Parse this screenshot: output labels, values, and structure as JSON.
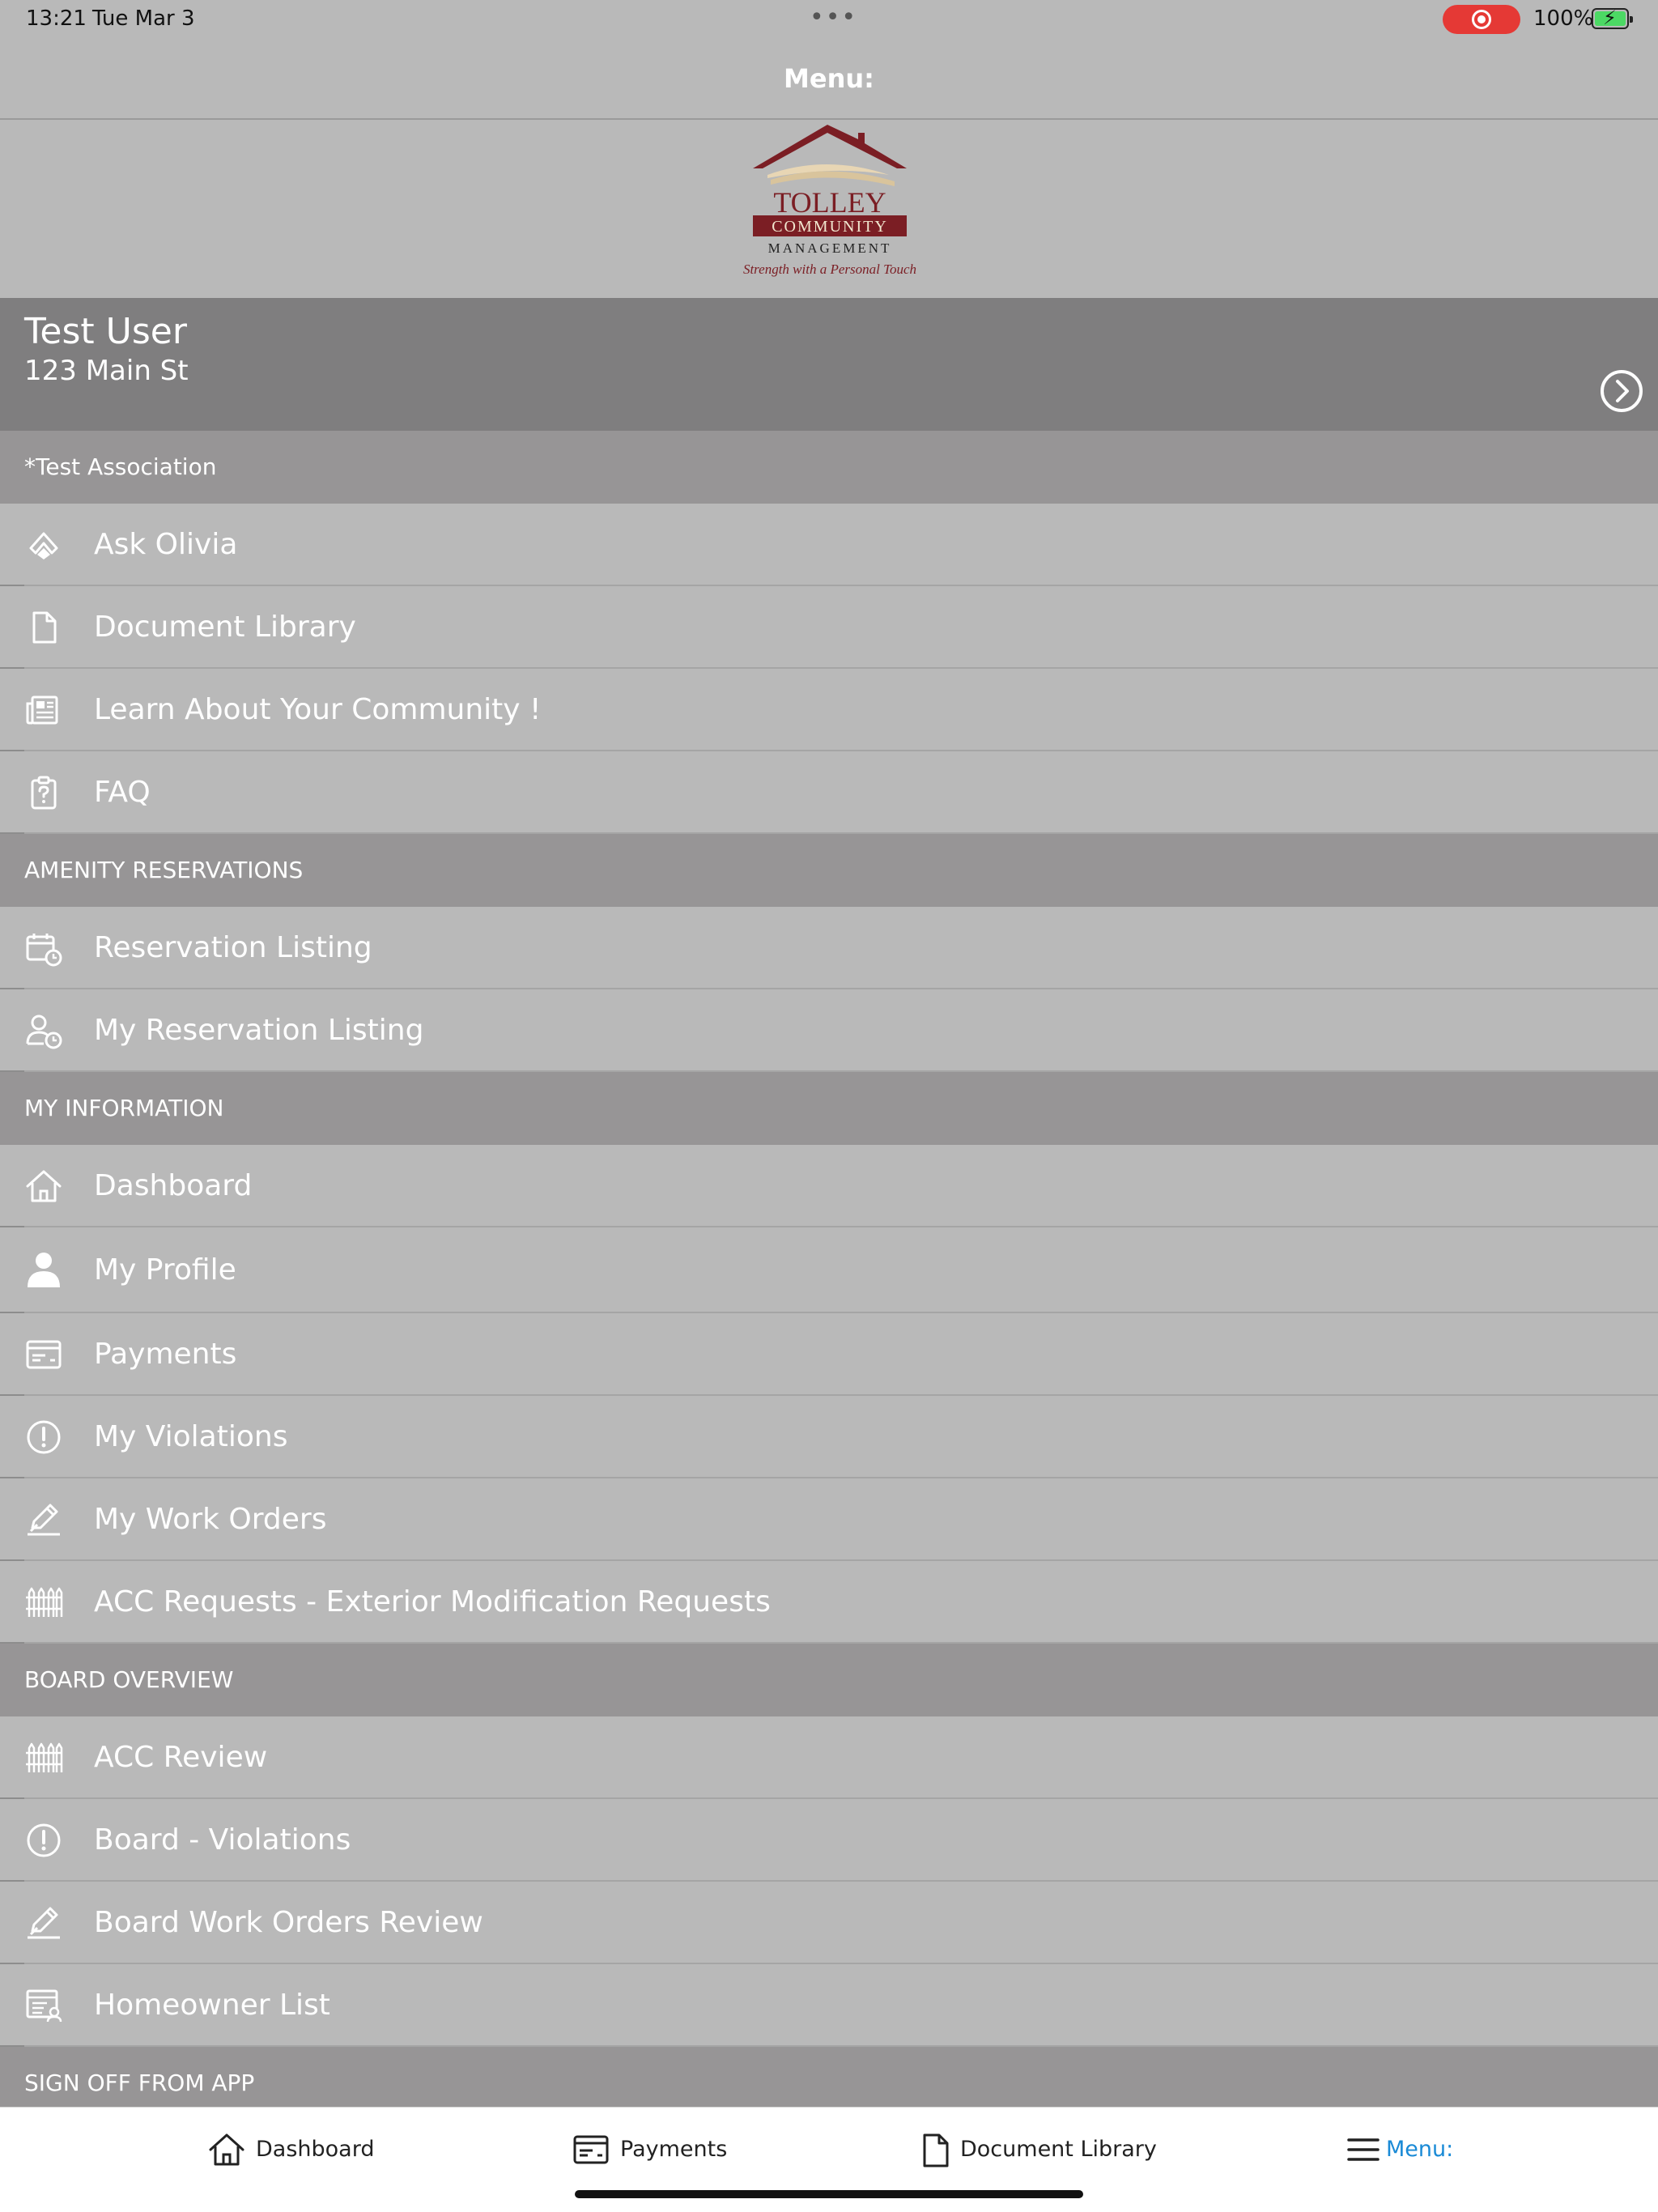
{
  "status_bar": {
    "time": "13:21",
    "date": "Tue Mar 3",
    "battery_percent": "100%",
    "recording_color": "#e53935",
    "battery_color": "#4cd964"
  },
  "nav": {
    "title": "Menu:"
  },
  "logo": {
    "line1": "TOLLEY",
    "line2": "COMMUNITY",
    "line3": "MANAGEMENT",
    "tagline": "Strength with a Personal Touch",
    "brand_color": "#7b1e24"
  },
  "user": {
    "name": "Test User",
    "address": "123 Main St"
  },
  "sections": {
    "association": "*Test Association",
    "amenity": "AMENITY RESERVATIONS",
    "my_info": "MY INFORMATION",
    "board": "BOARD OVERVIEW",
    "sign_off": "SIGN OFF FROM APP"
  },
  "items": {
    "ask_olivia": "Ask Olivia",
    "document_library": "Document Library",
    "learn_community": "Learn About Your Community !",
    "faq": "FAQ",
    "reservation_listing": "Reservation Listing",
    "my_reservation_listing": "My Reservation Listing",
    "dashboard": "Dashboard",
    "my_profile": "My Profile",
    "payments": "Payments",
    "my_violations": "My Violations",
    "my_work_orders": "My Work Orders",
    "acc_requests": "ACC Requests - Exterior Modification Requests",
    "acc_review": "ACC Review",
    "board_violations": "Board - Violations",
    "board_work_orders": "Board Work Orders Review",
    "homeowner_list": "Homeowner List"
  },
  "tabbar": {
    "dashboard": "Dashboard",
    "payments": "Payments",
    "document_library": "Document Library",
    "menu": "Menu:",
    "active_color": "#1a8ad6"
  }
}
